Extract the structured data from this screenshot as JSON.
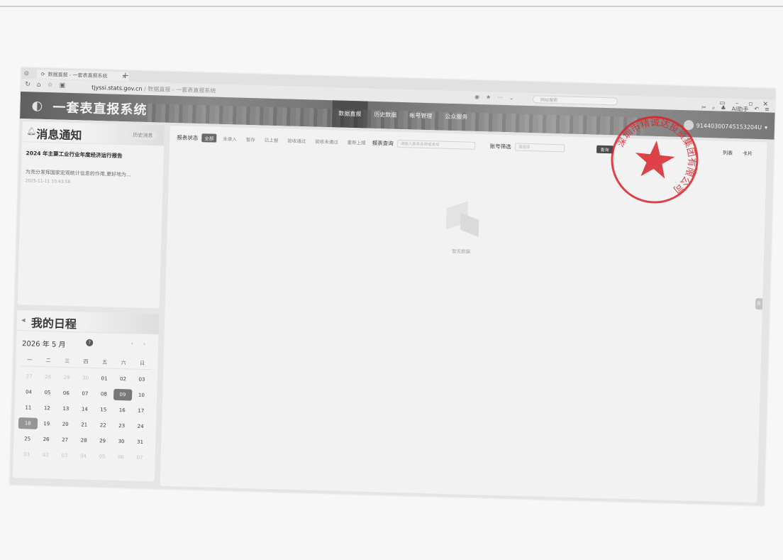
{
  "browser": {
    "tab_title": "数据直报 - 一套表直报系统",
    "new_tab": "+",
    "url_host": "tjyssi.stats.gov.cn",
    "url_path": "/ 数据直报 - 一套表直报系统",
    "search_placeholder": "网址搜索",
    "ai_assistant": "AI助手"
  },
  "header": {
    "system_title": "一套表直报系统",
    "nav": [
      "数据直报",
      "历史数据",
      "帐号管理",
      "公众服务"
    ],
    "active_nav": 0,
    "user_code": "91440300745153204U"
  },
  "notices": {
    "title": "消息通知",
    "history_button": "历史消息",
    "items": [
      {
        "title": "2024 年主要工业行业年度经济运行报告",
        "desc": "为充分发挥国家宏观统计信息的作用,更好地为...",
        "time": "2025-11-11 10:43:58"
      }
    ]
  },
  "schedule": {
    "title": "我的日程",
    "month_label": "2026 年 5 月",
    "help": "?",
    "prev": "‹",
    "next": "›",
    "weekdays": [
      "一",
      "二",
      "三",
      "四",
      "五",
      "六",
      "日"
    ],
    "weeks": [
      [
        "27",
        "28",
        "29",
        "30",
        "01",
        "02",
        "03"
      ],
      [
        "04",
        "05",
        "06",
        "07",
        "08",
        "09",
        "10"
      ],
      [
        "11",
        "12",
        "13",
        "14",
        "15",
        "16",
        "17"
      ],
      [
        "18",
        "19",
        "20",
        "21",
        "22",
        "23",
        "24"
      ],
      [
        "25",
        "26",
        "27",
        "28",
        "29",
        "30",
        "31"
      ],
      [
        "01",
        "02",
        "03",
        "04",
        "05",
        "06",
        "07"
      ]
    ],
    "today": "09",
    "selected": "18"
  },
  "filters": {
    "status_label": "报表状态",
    "statuses": [
      "全部",
      "未录入",
      "暂存",
      "已上报",
      "验收通过",
      "验收未通过",
      "重新上报"
    ],
    "active_status": 0,
    "query_label": "报表查询",
    "query_placeholder": "请输入报表名称或表号",
    "account_label": "账号筛选",
    "account_placeholder": "请选择",
    "search_button": "查询",
    "view_list": "列表",
    "view_card": "卡片"
  },
  "empty_state": {
    "text": "暂无数据"
  },
  "side_tab": "反馈",
  "seal": {
    "text": "深圳市精诚达投资集团有限公司"
  },
  "colors": {
    "seal_red": "#d8232a",
    "header_gray": "#7a7a7a"
  }
}
